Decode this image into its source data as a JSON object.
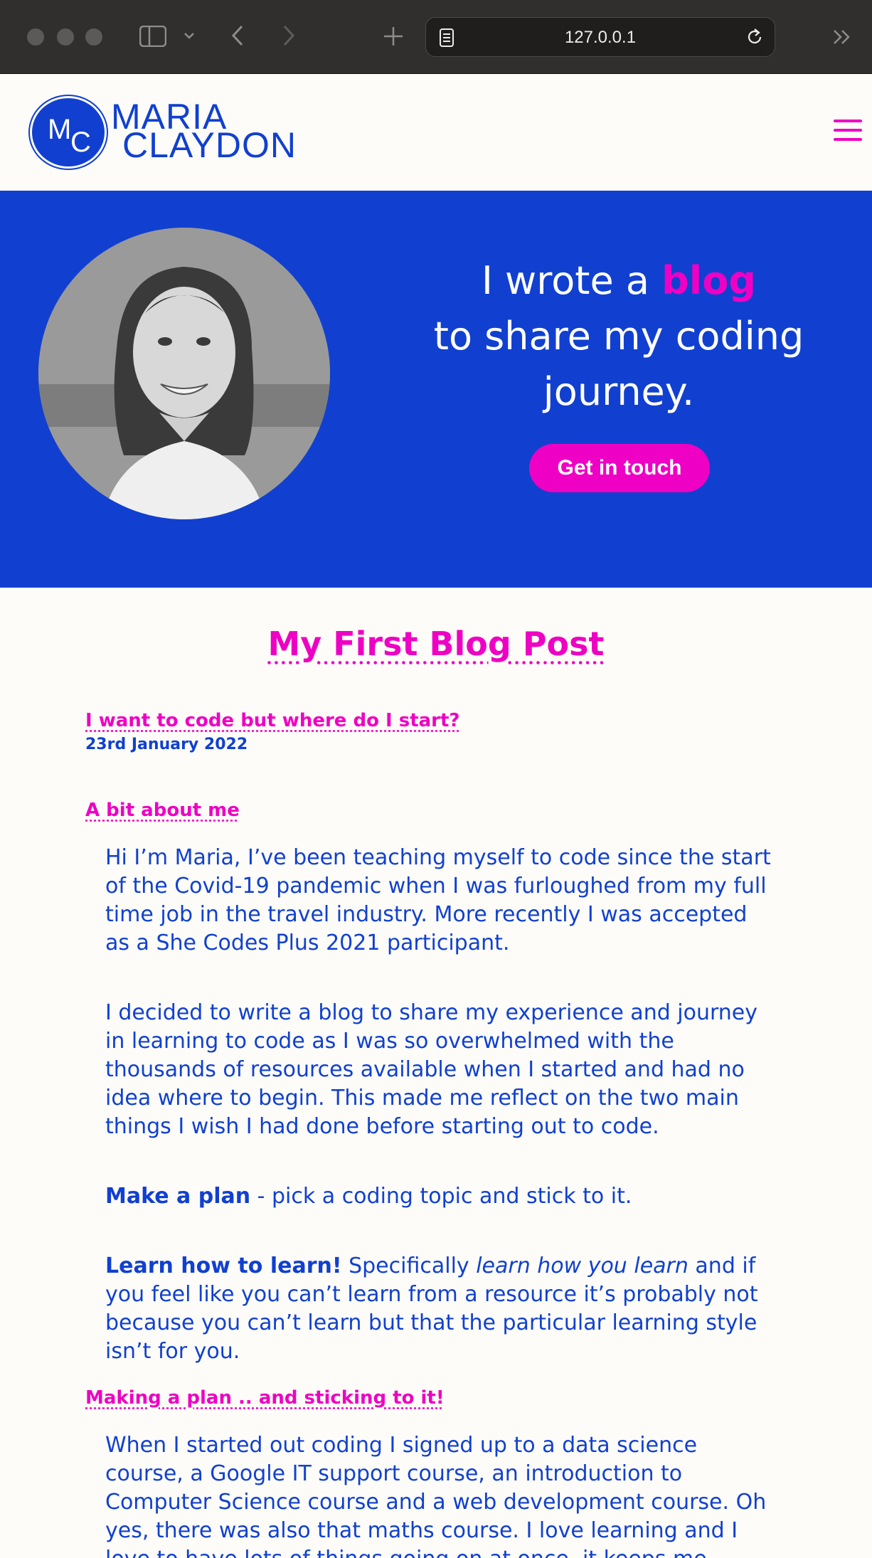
{
  "browser": {
    "url": "127.0.0.1",
    "colors": {
      "chrome": "#302f2d",
      "urlbar": "#1f1e1d"
    }
  },
  "header": {
    "logo_initial_m": "M",
    "logo_initial_c": "C",
    "name_first": "MARIA",
    "name_last": "CLAYDON"
  },
  "hero": {
    "line_prefix": "I wrote a ",
    "accent_word": "blog",
    "line_2": "to share my coding",
    "line_3": "journey.",
    "cta_label": "Get in touch"
  },
  "post": {
    "title": "My First Blog Post",
    "subtitle_link": "I want to code but where do I start?",
    "date": "23rd January 2022",
    "section_1": "A bit about me",
    "p1": "Hi I’m Maria, I’ve been teaching myself to code since the start of the Covid-19 pandemic when I was furloughed from my full time job in the travel industry. More recently I was accepted as a She Codes Plus 2021 participant.",
    "p2": "I decided to write a blog to share my experience and journey in learning to code as I was so overwhelmed with the thousands of resources available when I started and had no idea where to begin. This made me reflect on the two main things I wish I had done before starting out to code.",
    "p3_bold": "Make a plan",
    "p3_rest": " - pick a coding topic and stick to it.",
    "p4_bold": "Learn how to learn!",
    "p4_mid": " Specifically ",
    "p4_italic": "learn how you learn",
    "p4_rest": " and if you feel like you can’t learn from a resource it’s probably not because you can’t learn but that the particular learning style isn’t for you.",
    "section_2": "Making a plan .. and sticking to it!",
    "p5": "When I started out coding I signed up to a data science course, a Google IT support course, an introduction to Computer Science course and a web development course. Oh yes, there was also that maths course. I love learning and I love to have lots of things going on at once, it keeps me engaged"
  },
  "theme": {
    "primary": "#1140d0",
    "accent": "#ee00c4",
    "background": "#fdfcf8"
  }
}
